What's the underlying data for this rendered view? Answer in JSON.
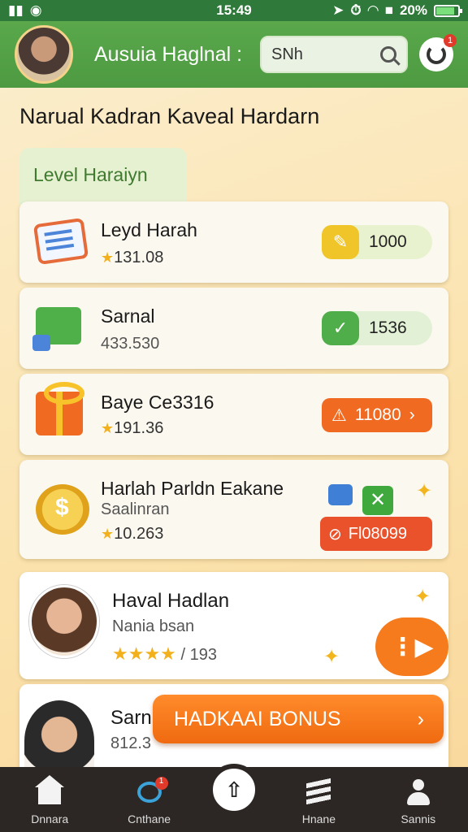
{
  "status_bar": {
    "time": "15:49",
    "battery": "20%"
  },
  "header": {
    "title": "Ausuia Haglnal :"
  },
  "search": {
    "value": "SNh",
    "placeholder": ""
  },
  "notifications": {
    "badge": "1"
  },
  "page": {
    "title": "Narual Kadran Kaveal Hardarn"
  },
  "level_tab": {
    "label": "Level Haraiyn"
  },
  "items": [
    {
      "title": "Leyd Harah",
      "rating": "131.08",
      "pill_value": "1000",
      "pill_color": "#e9f2cf",
      "pill_icon_color": "#f0c52a"
    },
    {
      "title": "Sarnal",
      "sub": "433.530",
      "pill_value": "1536",
      "pill_color": "#e2f1d6",
      "pill_icon_color": "#4fae4a"
    },
    {
      "title": "Baye Ce3316",
      "rating": "191.36",
      "pill_value": "11080",
      "pill_color": "#f06a22"
    },
    {
      "title": "Harlah Parldn Eakane",
      "sub": "Saalinran",
      "rating": "10.263",
      "pill_value": "Fl08099",
      "pill_color": "#e9522a"
    }
  ],
  "reviews": [
    {
      "name": "Haval Hadlan",
      "sub": "Nania bsan",
      "rating_text": "/ 193",
      "stars": 4
    },
    {
      "name": "Sarn",
      "sub": "812.3"
    }
  ],
  "bonus": {
    "label": "HADKAAI BONUS"
  },
  "nav": {
    "items": [
      {
        "label": "Dnnara"
      },
      {
        "label": "Cnthane"
      },
      {
        "label": "Hnane"
      },
      {
        "label": "Sannis"
      }
    ],
    "chat_badge": "1"
  }
}
